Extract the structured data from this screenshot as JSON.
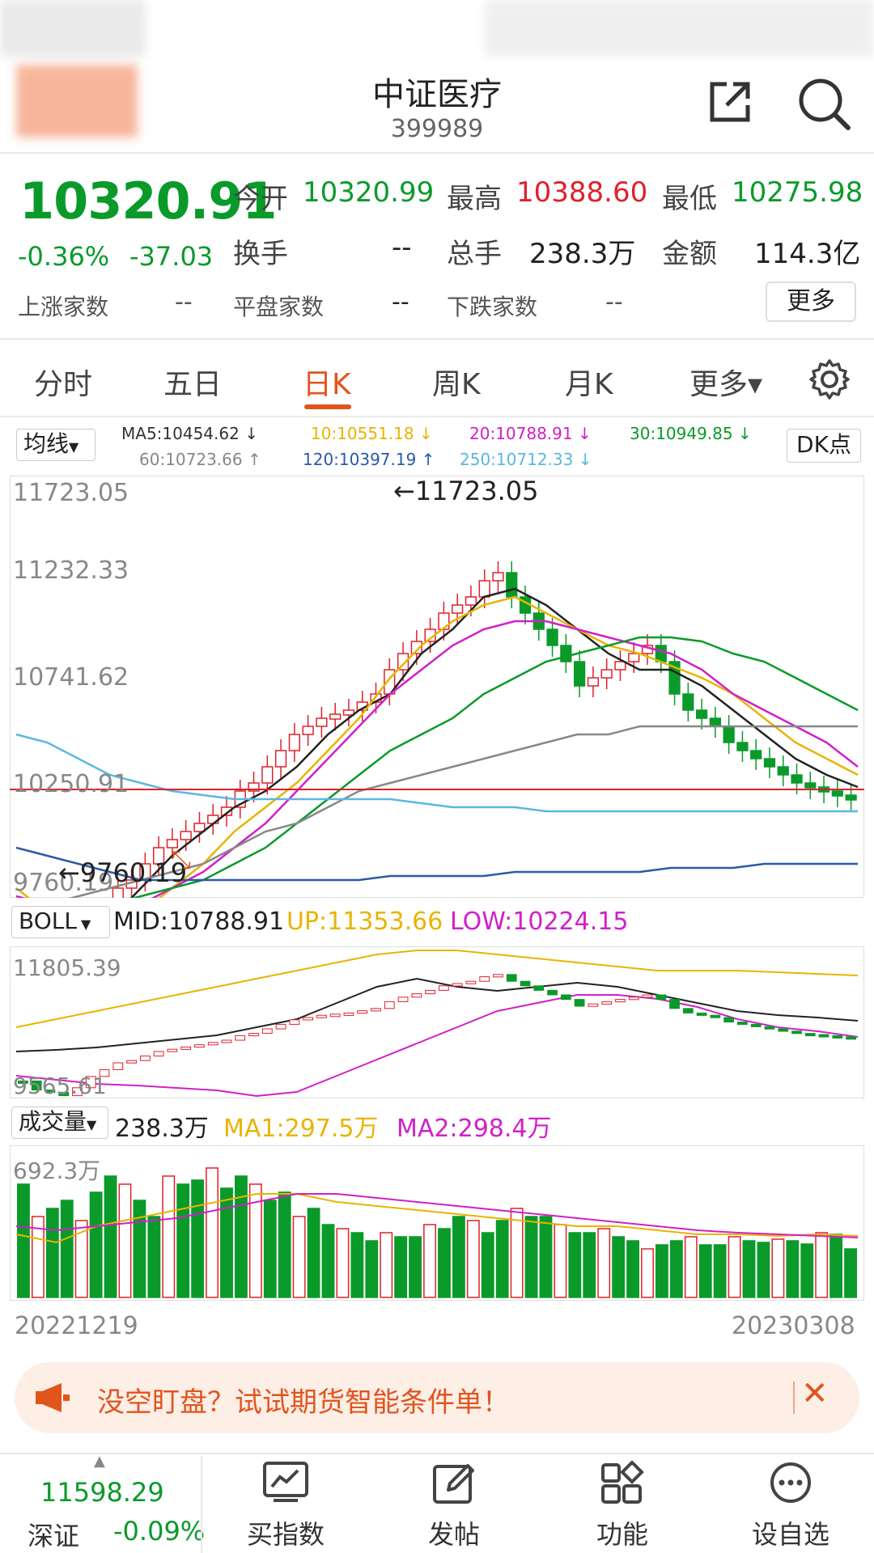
{
  "header": {
    "title": "中证医疗",
    "code": "399989"
  },
  "quote": {
    "price": "10320.91",
    "change_pct": "-0.36%",
    "change": "-37.03",
    "open_label": "今开",
    "open": "10320.99",
    "high_label": "最高",
    "high": "10388.60",
    "low_label": "最低",
    "low": "10275.98",
    "turnover_label": "换手",
    "turnover": "--",
    "volume_label": "总手",
    "volume": "238.3万",
    "amount_label": "金额",
    "amount": "114.3亿",
    "up_label": "上涨家数",
    "up": "--",
    "flat_label": "平盘家数",
    "flat": "--",
    "down_label": "下跌家数",
    "down": "--",
    "more_label": "更多"
  },
  "tabs": [
    {
      "label": "分时"
    },
    {
      "label": "五日"
    },
    {
      "label": "日K"
    },
    {
      "label": "周K"
    },
    {
      "label": "月K"
    },
    {
      "label": "更多▾"
    }
  ],
  "ma": {
    "select_label": "均线",
    "ma5": "MA5:10454.62 ↓",
    "ma10": "10:10551.18 ↓",
    "ma20": "20:10788.91 ↓",
    "ma30": "30:10949.85 ↓",
    "ma60": "60:10723.66 ↑",
    "ma120": "120:10397.19 ↑",
    "ma250": "250:10712.33 ↓",
    "dk_label": "DK点"
  },
  "kline": {
    "y_labels": [
      "11723.05",
      "11232.33",
      "10741.62",
      "10250.91",
      "9760.19"
    ],
    "max_marker": "11723.05",
    "min_marker": "9760.19"
  },
  "boll": {
    "select_label": "BOLL",
    "mid": "MID:10788.91",
    "up": "UP:11353.66",
    "low": "LOW:10224.15",
    "y_top": "11805.39",
    "y_bottom": "9565.61"
  },
  "volume_panel": {
    "select_label": "成交量",
    "current": "238.3万",
    "ma1": "MA1:297.5万",
    "ma2": "MA2:298.4万",
    "y_top": "692.3万"
  },
  "dates": {
    "start": "20221219",
    "end": "20230308"
  },
  "banner": {
    "text": "没空盯盘？试试期货智能条件单！"
  },
  "bottom_nav": {
    "index_value": "11598.29",
    "index_name": "深证",
    "index_change": "-0.09%",
    "items": [
      {
        "label": "买指数"
      },
      {
        "label": "发帖"
      },
      {
        "label": "功能"
      },
      {
        "label": "设自选"
      }
    ]
  },
  "colors": {
    "up": "#e0202a",
    "down": "#0a9a2a",
    "accent": "#e0551e"
  }
}
